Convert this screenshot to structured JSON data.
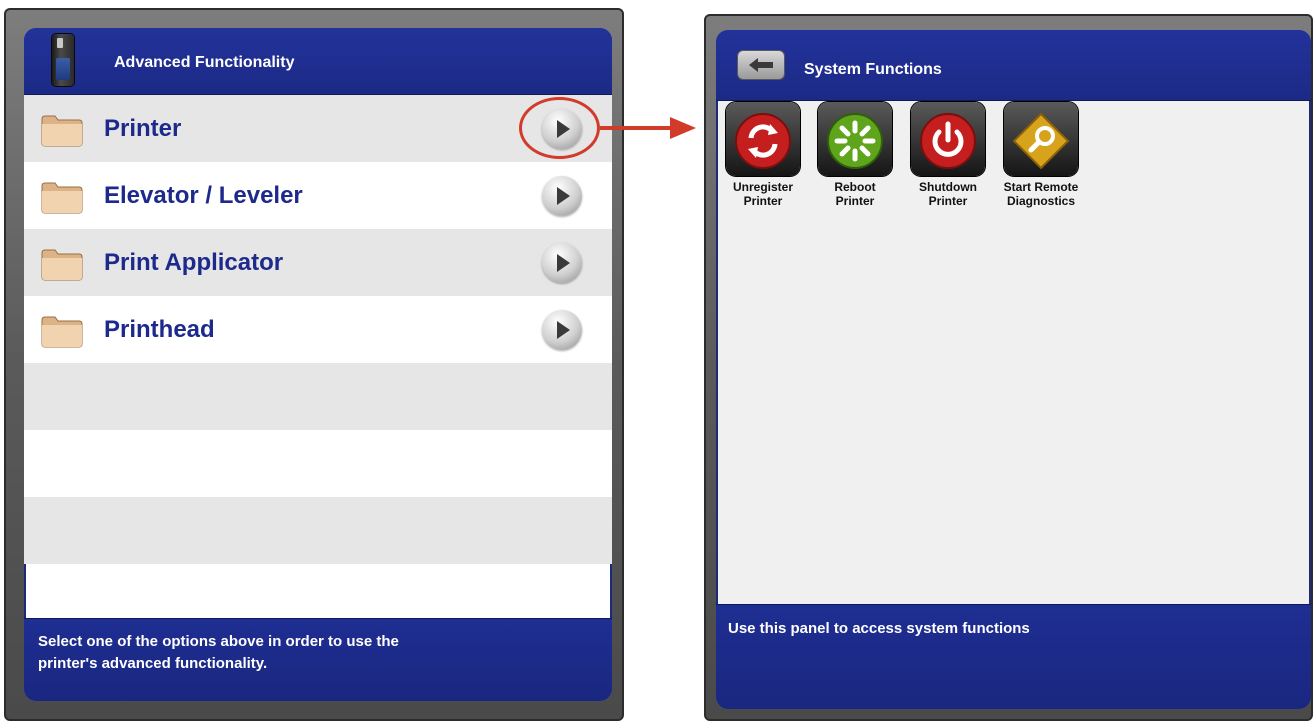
{
  "left_panel": {
    "title": "Advanced Functionality",
    "icon": "printer-icon",
    "items": [
      {
        "label": "Printer"
      },
      {
        "label": "Elevator / Leveler"
      },
      {
        "label": "Print Applicator"
      },
      {
        "label": "Printhead"
      }
    ],
    "footer": "Select one of the options above in order to use the printer's advanced functionality."
  },
  "right_panel": {
    "title": "System Functions",
    "back_icon": "back-arrow-icon",
    "functions": [
      {
        "label": "Unregister Printer",
        "icon": "unregister-icon",
        "color": "#c41e1e"
      },
      {
        "label": "Reboot Printer",
        "icon": "reboot-icon",
        "color": "#5ea51c"
      },
      {
        "label": "Shutdown Printer",
        "icon": "power-icon",
        "color": "#c41e1e"
      },
      {
        "label": "Start Remote Diagnostics",
        "icon": "search-icon",
        "color": "#d8a31c"
      }
    ],
    "footer": "Use this panel to access system functions"
  },
  "colors": {
    "header_blue": "#1c2a86",
    "label_blue": "#1d2a8c",
    "callout_red": "#d23a2a"
  }
}
